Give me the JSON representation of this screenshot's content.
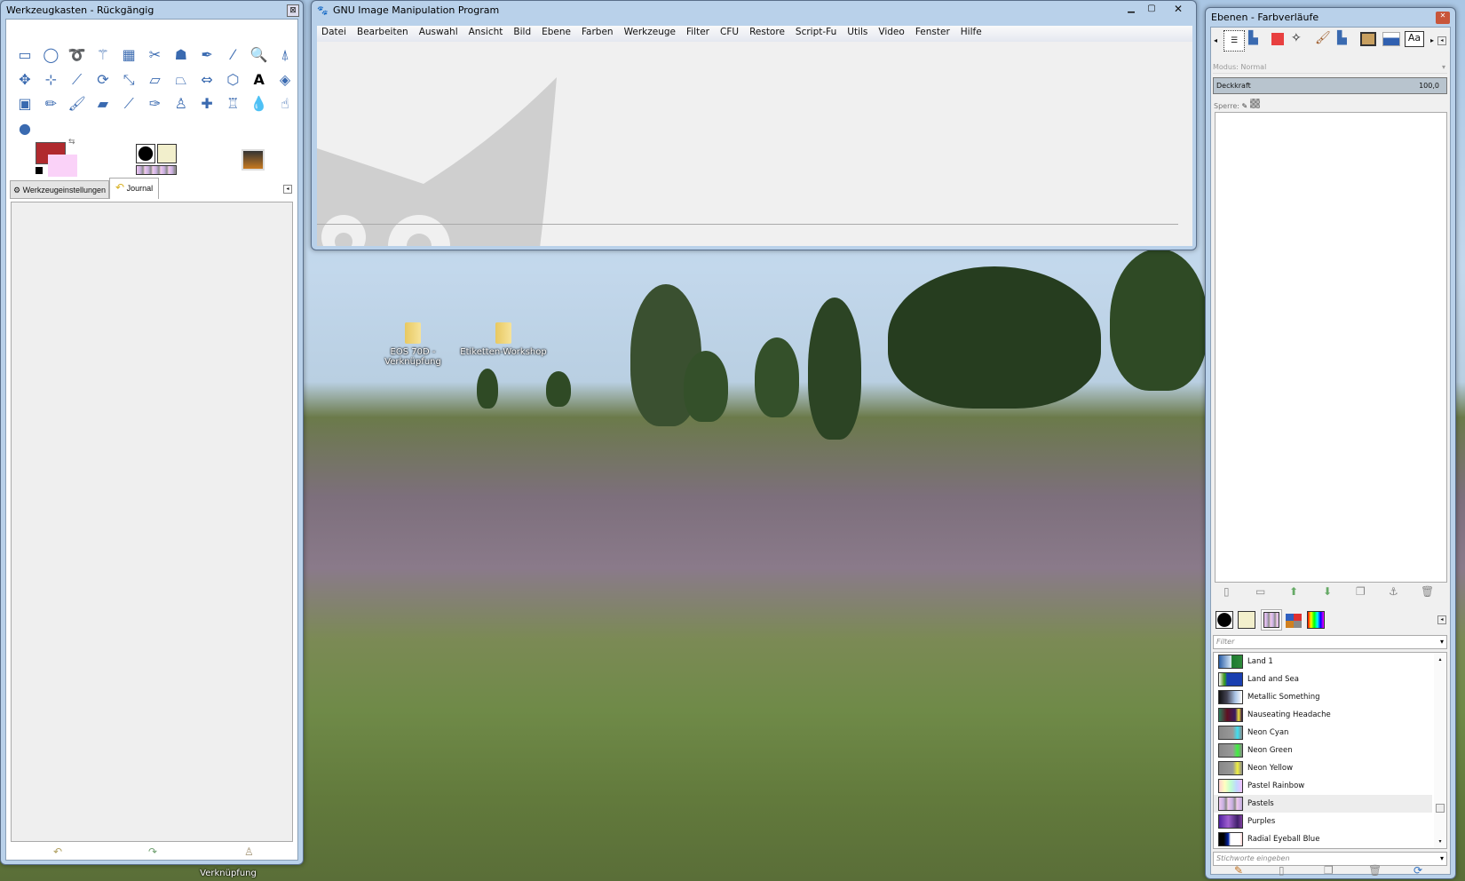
{
  "toolbox": {
    "title": "Werkzeugkasten - Rückgängig",
    "tools": [
      {
        "name": "rect-select",
        "g": "▭"
      },
      {
        "name": "ellipse-select",
        "g": "◯"
      },
      {
        "name": "free-select",
        "g": "➰"
      },
      {
        "name": "fuzzy-select",
        "g": "⚚"
      },
      {
        "name": "color-select",
        "g": "▦"
      },
      {
        "name": "scissors",
        "g": "✂"
      },
      {
        "name": "foreground-select",
        "g": "☗"
      },
      {
        "name": "paths",
        "g": "✒"
      },
      {
        "name": "color-picker",
        "g": "⁄"
      },
      {
        "name": "zoom",
        "g": "🔍"
      },
      {
        "name": "measure",
        "g": "⍋"
      },
      {
        "name": "move",
        "g": "✥"
      },
      {
        "name": "align",
        "g": "⊹"
      },
      {
        "name": "crop",
        "g": "⟋"
      },
      {
        "name": "rotate",
        "g": "⟳"
      },
      {
        "name": "scale",
        "g": "⤡"
      },
      {
        "name": "shear",
        "g": "▱"
      },
      {
        "name": "perspective",
        "g": "⏢"
      },
      {
        "name": "flip",
        "g": "⇔"
      },
      {
        "name": "cage",
        "g": "⬡"
      },
      {
        "name": "text",
        "g": "A"
      },
      {
        "name": "bucket-fill",
        "g": "◈"
      },
      {
        "name": "blend",
        "g": "▣"
      },
      {
        "name": "pencil",
        "g": "✏"
      },
      {
        "name": "paintbrush",
        "g": "🖌"
      },
      {
        "name": "eraser",
        "g": "▰"
      },
      {
        "name": "airbrush",
        "g": "⟋"
      },
      {
        "name": "ink",
        "g": "✑"
      },
      {
        "name": "clone",
        "g": "♙"
      },
      {
        "name": "heal",
        "g": "✚"
      },
      {
        "name": "perspective-clone",
        "g": "♖"
      },
      {
        "name": "blur",
        "g": "💧"
      },
      {
        "name": "smudge",
        "g": "☝"
      },
      {
        "name": "dodge-burn",
        "g": "●"
      }
    ],
    "tabs": [
      "Werkzeugeinstellungen",
      "Journal"
    ]
  },
  "main": {
    "title": "GNU Image Manipulation Program",
    "menu": [
      "Datei",
      "Bearbeiten",
      "Auswahl",
      "Ansicht",
      "Bild",
      "Ebene",
      "Farben",
      "Werkzeuge",
      "Filter",
      "CFU",
      "Restore",
      "Script-Fu",
      "Utils",
      "Video",
      "Fenster",
      "Hilfe"
    ]
  },
  "dock": {
    "title": "Ebenen - Farbverläufe",
    "mode_label": "Modus:",
    "mode_value": "Normal",
    "opacity_label": "Deckkraft",
    "opacity_value": "100,0",
    "lock_label": "Sperre:",
    "filter_placeholder": "Filter",
    "tags_placeholder": "Stichworte eingeben",
    "gradients": [
      {
        "name": "Land 1",
        "c": "linear-gradient(90deg,#2a5fa8,#cfe2f4 50%,#fff 52%,#1e7a30 55%,#2e8a3a)"
      },
      {
        "name": "Land and Sea",
        "c": "linear-gradient(90deg,#fff,#5a9a30 20%,#2ca020 25%,#1a3fb0 35%,#1a3fb0)"
      },
      {
        "name": "Metallic Something",
        "c": "linear-gradient(90deg,#111,#445,#aac4e6 70%,#fff)"
      },
      {
        "name": "Nauseating Headache",
        "c": "linear-gradient(90deg,#2a7a5a,#601020 35%,#3a1a60 70%,#f0e040 85%,#301040)"
      },
      {
        "name": "Neon Cyan",
        "c": "linear-gradient(90deg,#888,#999 60%,#40e0f0 80%,#888)"
      },
      {
        "name": "Neon Green",
        "c": "linear-gradient(90deg,#888,#999 60%,#40f040 80%,#888)"
      },
      {
        "name": "Neon Yellow",
        "c": "linear-gradient(90deg,#888,#999 60%,#f0f040 80%,#888)"
      },
      {
        "name": "Pastel Rainbow",
        "c": "linear-gradient(90deg,#ffd0d0,#ffffc0,#c0ffd0,#c0d8ff,#f0c0ff)"
      },
      {
        "name": "Pastels",
        "c": "repeating-linear-gradient(90deg,#f0c8f0 0,#c8b0e0 5px,#888 8px,#f0d0e0 10px)"
      },
      {
        "name": "Purples",
        "c": "linear-gradient(90deg,#5020a0,#a060d0 40%,#40206a 80%,#8040a0)"
      },
      {
        "name": "Radial Eyeball Blue",
        "c": "linear-gradient(90deg,#000,#000 20%,#0020a0 40%,#fff 50%,#fff 90%,#fcc)"
      }
    ],
    "selected_gradient": 8
  },
  "desktop": {
    "icons": [
      "EOS 70D - Verknüpfung",
      "Etiketten-Workshop"
    ],
    "partial_label": "Verknüpfung"
  }
}
